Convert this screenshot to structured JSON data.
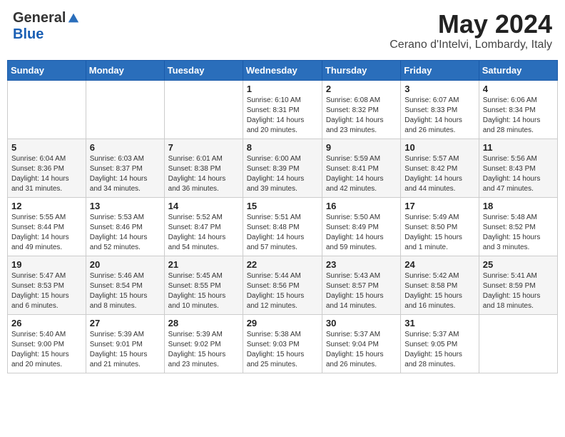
{
  "header": {
    "logo_general": "General",
    "logo_blue": "Blue",
    "month_year": "May 2024",
    "location": "Cerano d'Intelvi, Lombardy, Italy"
  },
  "weekdays": [
    "Sunday",
    "Monday",
    "Tuesday",
    "Wednesday",
    "Thursday",
    "Friday",
    "Saturday"
  ],
  "weeks": [
    [
      {
        "day": "",
        "info": ""
      },
      {
        "day": "",
        "info": ""
      },
      {
        "day": "",
        "info": ""
      },
      {
        "day": "1",
        "info": "Sunrise: 6:10 AM\nSunset: 8:31 PM\nDaylight: 14 hours\nand 20 minutes."
      },
      {
        "day": "2",
        "info": "Sunrise: 6:08 AM\nSunset: 8:32 PM\nDaylight: 14 hours\nand 23 minutes."
      },
      {
        "day": "3",
        "info": "Sunrise: 6:07 AM\nSunset: 8:33 PM\nDaylight: 14 hours\nand 26 minutes."
      },
      {
        "day": "4",
        "info": "Sunrise: 6:06 AM\nSunset: 8:34 PM\nDaylight: 14 hours\nand 28 minutes."
      }
    ],
    [
      {
        "day": "5",
        "info": "Sunrise: 6:04 AM\nSunset: 8:36 PM\nDaylight: 14 hours\nand 31 minutes."
      },
      {
        "day": "6",
        "info": "Sunrise: 6:03 AM\nSunset: 8:37 PM\nDaylight: 14 hours\nand 34 minutes."
      },
      {
        "day": "7",
        "info": "Sunrise: 6:01 AM\nSunset: 8:38 PM\nDaylight: 14 hours\nand 36 minutes."
      },
      {
        "day": "8",
        "info": "Sunrise: 6:00 AM\nSunset: 8:39 PM\nDaylight: 14 hours\nand 39 minutes."
      },
      {
        "day": "9",
        "info": "Sunrise: 5:59 AM\nSunset: 8:41 PM\nDaylight: 14 hours\nand 42 minutes."
      },
      {
        "day": "10",
        "info": "Sunrise: 5:57 AM\nSunset: 8:42 PM\nDaylight: 14 hours\nand 44 minutes."
      },
      {
        "day": "11",
        "info": "Sunrise: 5:56 AM\nSunset: 8:43 PM\nDaylight: 14 hours\nand 47 minutes."
      }
    ],
    [
      {
        "day": "12",
        "info": "Sunrise: 5:55 AM\nSunset: 8:44 PM\nDaylight: 14 hours\nand 49 minutes."
      },
      {
        "day": "13",
        "info": "Sunrise: 5:53 AM\nSunset: 8:46 PM\nDaylight: 14 hours\nand 52 minutes."
      },
      {
        "day": "14",
        "info": "Sunrise: 5:52 AM\nSunset: 8:47 PM\nDaylight: 14 hours\nand 54 minutes."
      },
      {
        "day": "15",
        "info": "Sunrise: 5:51 AM\nSunset: 8:48 PM\nDaylight: 14 hours\nand 57 minutes."
      },
      {
        "day": "16",
        "info": "Sunrise: 5:50 AM\nSunset: 8:49 PM\nDaylight: 14 hours\nand 59 minutes."
      },
      {
        "day": "17",
        "info": "Sunrise: 5:49 AM\nSunset: 8:50 PM\nDaylight: 15 hours\nand 1 minute."
      },
      {
        "day": "18",
        "info": "Sunrise: 5:48 AM\nSunset: 8:52 PM\nDaylight: 15 hours\nand 3 minutes."
      }
    ],
    [
      {
        "day": "19",
        "info": "Sunrise: 5:47 AM\nSunset: 8:53 PM\nDaylight: 15 hours\nand 6 minutes."
      },
      {
        "day": "20",
        "info": "Sunrise: 5:46 AM\nSunset: 8:54 PM\nDaylight: 15 hours\nand 8 minutes."
      },
      {
        "day": "21",
        "info": "Sunrise: 5:45 AM\nSunset: 8:55 PM\nDaylight: 15 hours\nand 10 minutes."
      },
      {
        "day": "22",
        "info": "Sunrise: 5:44 AM\nSunset: 8:56 PM\nDaylight: 15 hours\nand 12 minutes."
      },
      {
        "day": "23",
        "info": "Sunrise: 5:43 AM\nSunset: 8:57 PM\nDaylight: 15 hours\nand 14 minutes."
      },
      {
        "day": "24",
        "info": "Sunrise: 5:42 AM\nSunset: 8:58 PM\nDaylight: 15 hours\nand 16 minutes."
      },
      {
        "day": "25",
        "info": "Sunrise: 5:41 AM\nSunset: 8:59 PM\nDaylight: 15 hours\nand 18 minutes."
      }
    ],
    [
      {
        "day": "26",
        "info": "Sunrise: 5:40 AM\nSunset: 9:00 PM\nDaylight: 15 hours\nand 20 minutes."
      },
      {
        "day": "27",
        "info": "Sunrise: 5:39 AM\nSunset: 9:01 PM\nDaylight: 15 hours\nand 21 minutes."
      },
      {
        "day": "28",
        "info": "Sunrise: 5:39 AM\nSunset: 9:02 PM\nDaylight: 15 hours\nand 23 minutes."
      },
      {
        "day": "29",
        "info": "Sunrise: 5:38 AM\nSunset: 9:03 PM\nDaylight: 15 hours\nand 25 minutes."
      },
      {
        "day": "30",
        "info": "Sunrise: 5:37 AM\nSunset: 9:04 PM\nDaylight: 15 hours\nand 26 minutes."
      },
      {
        "day": "31",
        "info": "Sunrise: 5:37 AM\nSunset: 9:05 PM\nDaylight: 15 hours\nand 28 minutes."
      },
      {
        "day": "",
        "info": ""
      }
    ]
  ]
}
